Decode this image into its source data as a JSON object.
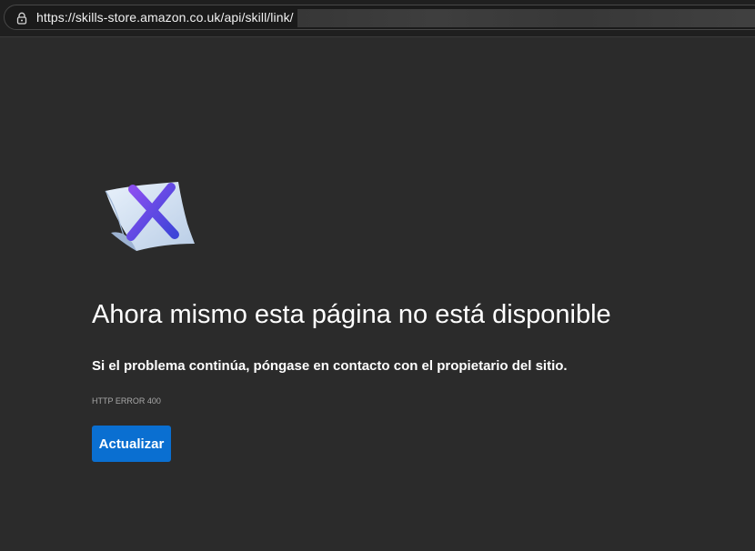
{
  "browser": {
    "url": "https://skills-store.amazon.co.uk/api/skill/link/"
  },
  "error_page": {
    "title": "Ahora mismo esta página no está disponible",
    "message": "Si el problema continúa, póngase en contacto con el propietario del sitio.",
    "error_code": "HTTP ERROR 400",
    "reload_label": "Actualizar",
    "illustration_icon": "broken-page-x-icon"
  },
  "colors": {
    "background": "#2b2b2b",
    "accent": "#0a6fd1",
    "x_mark": "#5b3fd6"
  }
}
